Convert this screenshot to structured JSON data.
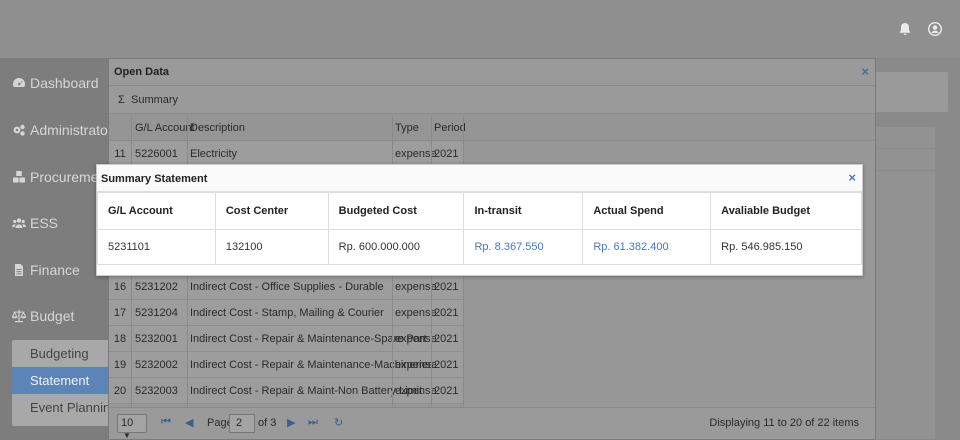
{
  "sidebar": {
    "items": [
      {
        "label": "Dashboard",
        "icon": "dashboard-icon"
      },
      {
        "label": "Administrator",
        "icon": "cogs-icon"
      },
      {
        "label": "Procurement",
        "icon": "cubes-icon"
      },
      {
        "label": "ESS",
        "icon": "users-icon"
      },
      {
        "label": "Finance",
        "icon": "file-icon"
      },
      {
        "label": "Budget",
        "icon": "balance-scale-icon"
      }
    ],
    "submenu": [
      "Budgeting",
      "Statement",
      "Event Planning"
    ],
    "active_submenu": "Statement"
  },
  "open_data": {
    "title": "Open Data",
    "close": "×",
    "summary_icon": "Σ",
    "summary_label": "Summary",
    "columns": [
      "G/L Account",
      "Description",
      "Type",
      "Period"
    ],
    "rows": [
      {
        "n": "11",
        "gl": "5226001",
        "desc": "Electricity",
        "type": "expense",
        "period": "2021"
      },
      {
        "n": "16",
        "gl": "5231202",
        "desc": "Indirect Cost - Office Supplies - Durable",
        "type": "expense",
        "period": "2021"
      },
      {
        "n": "17",
        "gl": "5231204",
        "desc": "Indirect Cost - Stamp, Mailing & Courier",
        "type": "expense",
        "period": "2021"
      },
      {
        "n": "18",
        "gl": "5232001",
        "desc": "Indirect Cost - Repair & Maintenance-Spare Part",
        "type": "expense",
        "period": "2021"
      },
      {
        "n": "19",
        "gl": "5232002",
        "desc": "Indirect Cost - Repair & Maintenance-Machineries",
        "type": "expense",
        "period": "2021"
      },
      {
        "n": "20",
        "gl": "5232003",
        "desc": "Indirect Cost - Repair & Maint-Non Battery Limit",
        "type": "expense",
        "period": "2021"
      }
    ],
    "pager": {
      "page_size": "10",
      "page_label": "Page",
      "page": "2",
      "of": "of 3",
      "display": "Displaying 11 to 20 of 22 items"
    }
  },
  "summary_statement": {
    "title": "Summary Statement",
    "close": "×",
    "headers": [
      "G/L Account",
      "Cost Center",
      "Budgeted Cost",
      "In-transit",
      "Actual Spend",
      "Avaliable Budget"
    ],
    "row": [
      "5231101",
      "132100",
      "Rp. 600.000.000",
      "Rp. 8.367.550",
      "Rp. 61.382.400",
      "Rp. 546.985.150"
    ]
  }
}
